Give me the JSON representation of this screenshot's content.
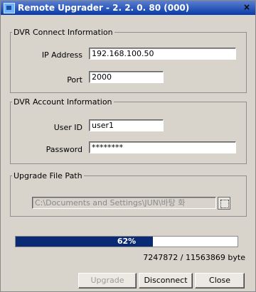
{
  "window": {
    "title": "Remote Upgrader - 2. 2. 0. 80 (000)",
    "close_glyph": "×"
  },
  "dvr_connect": {
    "legend": "DVR Connect Information",
    "ip_label": "IP Address",
    "ip_value": "192.168.100.50",
    "port_label": "Port",
    "port_value": "2000"
  },
  "dvr_account": {
    "legend": "DVR Account Information",
    "user_label": "User ID",
    "user_value": "user1",
    "password_label": "Password",
    "password_value": "********"
  },
  "upgrade_file": {
    "legend": "Upgrade File Path",
    "path_value": "C:\\Documents and Settings\\JUN\\바탕 화"
  },
  "progress": {
    "percent_label": "62%",
    "fraction": 0.62,
    "bytes_text": "7247872 / 11563869 byte"
  },
  "buttons": {
    "upgrade": "Upgrade",
    "disconnect": "Disconnect",
    "close": "Close"
  },
  "colors": {
    "titlebar": "#0a3aa8",
    "progress_fill": "#0b2a74",
    "dialog_bg": "#d8d4cc"
  }
}
